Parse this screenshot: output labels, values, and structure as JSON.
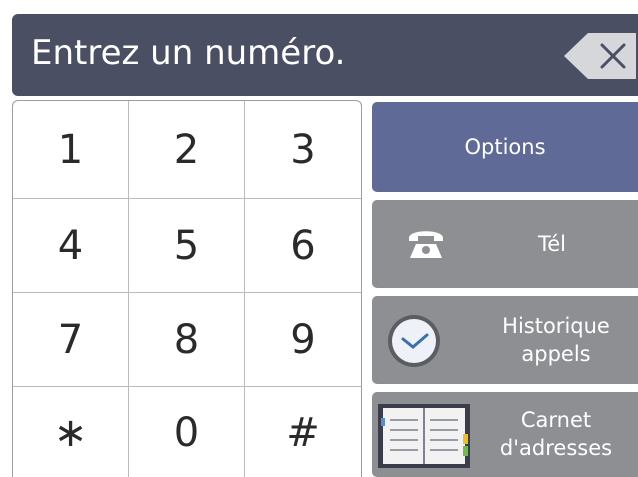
{
  "header": {
    "prompt": "Entrez un numéro."
  },
  "keypad": {
    "keys": [
      "1",
      "2",
      "3",
      "4",
      "5",
      "6",
      "7",
      "8",
      "9",
      "∗",
      "0",
      "#"
    ]
  },
  "buttons": {
    "options": "Options",
    "tel": "Tél",
    "history_line1": "Historique",
    "history_line2": "appels",
    "addressbook_line1": "Carnet",
    "addressbook_line2": "d'adresses"
  },
  "icons": {
    "backspace": "backspace-icon",
    "tel": "telephone-icon",
    "history": "clock-icon",
    "addressbook": "address-book-icon"
  },
  "colors": {
    "header_bg": "#4a4f63",
    "options_bg": "#5f6a96",
    "button_bg": "#8e8f93"
  }
}
